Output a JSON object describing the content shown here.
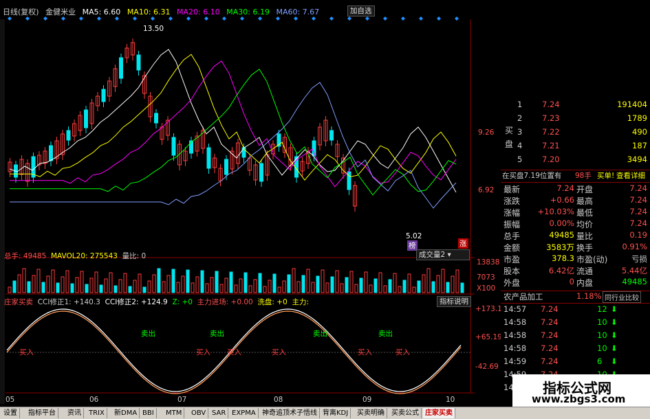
{
  "header": {
    "period": "日线(复权)",
    "stock_name": "金健米业",
    "ma5": "MA5: 6.60",
    "ma10": "MA10: 6.31",
    "ma20": "MA20: 6.10",
    "ma30": "MA30: 6.19",
    "ma60": "MA60: 7.67",
    "add_btn": "加自选"
  },
  "price_labels": {
    "high": "13.50",
    "p1": "9.26",
    "p2": "6.92",
    "low": "5.02",
    "flag_left": "榜",
    "flag_right": "涨"
  },
  "volume": {
    "label": "总手: 49485",
    "mavol": "MAVOL20: 275543",
    "ratio": "量比: 0",
    "dropdown": "成交量2",
    "axis": [
      "13838",
      "7073",
      "X100"
    ]
  },
  "indicator": {
    "name": "庄家买卖",
    "cci1": "CCI修正1: +140.3",
    "cci2": "CCI修正2: +124.9",
    "z": "Z: +0",
    "main": "主力进场: +0.00",
    "wash": "洗盘: +0",
    "main2": "主力:",
    "help_btn": "指标说明",
    "axis": [
      "+173.1",
      "+65.19",
      "-42.69"
    ],
    "buy": "买入",
    "sell": "卖出"
  },
  "dates": [
    "05",
    "06",
    "07",
    "08",
    "09",
    "10"
  ],
  "orderbook": {
    "side_label": "买盘",
    "rows": [
      {
        "level": "1",
        "price": "7.24",
        "vol": "191404"
      },
      {
        "level": "2",
        "price": "7.23",
        "vol": "1789"
      },
      {
        "level": "3",
        "price": "7.22",
        "vol": "490"
      },
      {
        "level": "4",
        "price": "7.21",
        "vol": "187"
      },
      {
        "level": "5",
        "price": "7.20",
        "vol": "3494"
      }
    ],
    "summary_a": "在买盘7.19位置有",
    "summary_b": "98手",
    "summary_c": "买单!",
    "summary_d": "查看详细"
  },
  "quote": [
    {
      "l1": "最新",
      "v1": "7.24",
      "l2": "开盘",
      "v2": "7.24"
    },
    {
      "l1": "涨跌",
      "v1": "+0.66",
      "l2": "最高",
      "v2": "7.24"
    },
    {
      "l1": "涨幅",
      "v1": "+10.03%",
      "l2": "最低",
      "v2": "7.24"
    },
    {
      "l1": "振幅",
      "v1": "0.00%",
      "l2": "均价",
      "v2": "7.24"
    },
    {
      "l1": "总手",
      "v1": "49485",
      "l2": "量比",
      "v2": "0.19"
    },
    {
      "l1": "金额",
      "v1": "3583万",
      "l2": "换手",
      "v2": "0.91%"
    },
    {
      "l1": "市盈",
      "v1": "378.3",
      "l2": "市盈(动)",
      "v2": "亏损"
    },
    {
      "l1": "股本",
      "v1": "6.42亿",
      "l2": "流通",
      "v2": "5.44亿"
    },
    {
      "l1": "外盘",
      "v1": "0",
      "l2": "内盘",
      "v2": "49485"
    }
  ],
  "industry": {
    "name": "农产品加工",
    "pct": "1.18%",
    "btn": "同行业比较"
  },
  "ticks": [
    {
      "t": "14:57",
      "p": "7.24",
      "v": "12"
    },
    {
      "t": "14:58",
      "p": "7.24",
      "v": "10"
    },
    {
      "t": "14:58",
      "p": "7.24",
      "v": "10"
    },
    {
      "t": "14:58",
      "p": "7.24",
      "v": "10"
    },
    {
      "t": "14:59",
      "p": "7.24",
      "v": "6"
    },
    {
      "t": "14:59",
      "p": "7.24",
      "v": "10"
    },
    {
      "t": "14:59",
      "p": "7.24",
      "v": "10"
    }
  ],
  "watermark": {
    "line1": "指标公式网",
    "line2": "www.zbgs3.com"
  },
  "tabs": [
    "设置",
    "指标平台",
    "资讯",
    "TRIX",
    "新DMA",
    "BBI",
    "MTM",
    "OBV",
    "SAR",
    "EXPMA",
    "神奇追顶术子悟线",
    "背离KDJ",
    "买卖明确",
    "买卖公式",
    "庄家买卖"
  ],
  "colors": {
    "up": "#ff3c3c",
    "down": "#00e5ee",
    "ma5": "#ffffff",
    "ma10": "#ffff00",
    "ma20": "#ff00ff",
    "ma30": "#00ff00",
    "ma60": "#80a0ff"
  }
}
